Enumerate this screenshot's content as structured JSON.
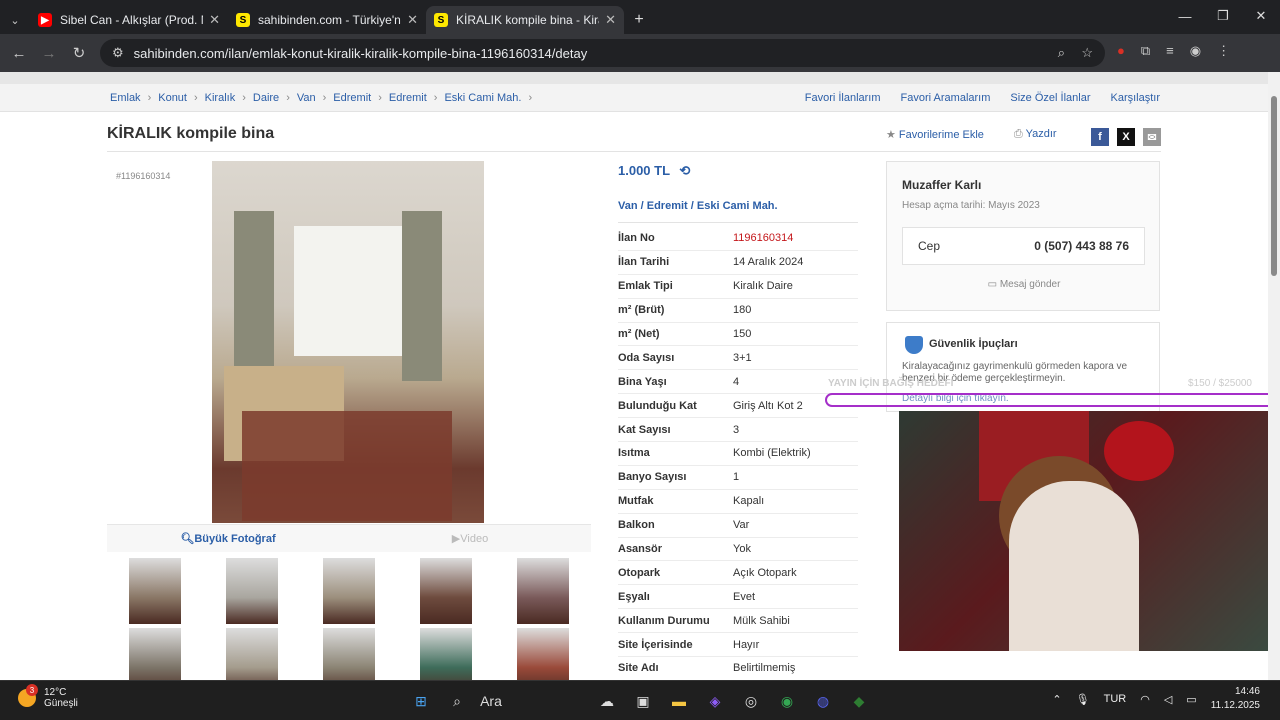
{
  "browser": {
    "tabs": [
      {
        "title": "Sibel Can - Alkışlar (Prod. M",
        "fav_color": "#ff0000",
        "fav_glyph": "▶",
        "active": false
      },
      {
        "title": "sahibinden.com - Türkiye'nin O",
        "fav_color": "#ffe800",
        "fav_glyph": "S",
        "active": false
      },
      {
        "title": "KİRALIK kompile bina - Kiralık D",
        "fav_color": "#ffe800",
        "fav_glyph": "S",
        "active": true
      }
    ],
    "new_tab_glyph": "+",
    "url": "sahibinden.com/ilan/emlak-konut-kiralik-kiralik-kompile-bina-1196160314/detay"
  },
  "breadcrumbs": [
    "Emlak",
    "Konut",
    "Kiralık",
    "Daire",
    "Van",
    "Edremit",
    "Edremit",
    "Eski Cami Mah."
  ],
  "top_links": [
    "Favori İlanlarım",
    "Favori Aramalarım",
    "Size Özel İlanlar",
    "Karşılaştır"
  ],
  "listing": {
    "title": "KİRALIK kompile bina",
    "number_tag": "#1196160314",
    "add_favorite": "Favorilerime Ekle",
    "print": "Yazdır",
    "price": "1.000 TL",
    "location": [
      "Van",
      "Edremit",
      "Eski Cami Mah."
    ],
    "big_photo": "Büyük Fotoğraf",
    "video": "Video"
  },
  "properties": [
    {
      "k": "İlan No",
      "v": "1196160314",
      "highlight": true
    },
    {
      "k": "İlan Tarihi",
      "v": "14 Aralık 2024"
    },
    {
      "k": "Emlak Tipi",
      "v": "Kiralık Daire"
    },
    {
      "k": "m² (Brüt)",
      "v": "180"
    },
    {
      "k": "m² (Net)",
      "v": "150"
    },
    {
      "k": "Oda Sayısı",
      "v": "3+1"
    },
    {
      "k": "Bina Yaşı",
      "v": "4"
    },
    {
      "k": "Bulunduğu Kat",
      "v": "Giriş Altı Kot 2"
    },
    {
      "k": "Kat Sayısı",
      "v": "3"
    },
    {
      "k": "Isıtma",
      "v": "Kombi (Elektrik)"
    },
    {
      "k": "Banyo Sayısı",
      "v": "1"
    },
    {
      "k": "Mutfak",
      "v": "Kapalı"
    },
    {
      "k": "Balkon",
      "v": "Var"
    },
    {
      "k": "Asansör",
      "v": "Yok"
    },
    {
      "k": "Otopark",
      "v": "Açık Otopark"
    },
    {
      "k": "Eşyalı",
      "v": "Evet"
    },
    {
      "k": "Kullanım Durumu",
      "v": "Mülk Sahibi"
    },
    {
      "k": "Site İçerisinde",
      "v": "Hayır"
    },
    {
      "k": "Site Adı",
      "v": "Belirtilmemiş"
    }
  ],
  "seller": {
    "name": "Muzaffer Karlı",
    "joined": "Hesap açma tarihi: Mayıs 2023",
    "phone_label": "Cep",
    "phone": "0 (507) 443 88 76",
    "message": "Mesaj gönder"
  },
  "safety": {
    "title": "Güvenlik İpuçları",
    "body": "Kiralayacağınız gayrimenkulü görmeden kapora ve benzeri bir ödeme gerçekleştirmeyin.",
    "link": "Detaylı bilgi için tıklayın."
  },
  "stream_overlay": {
    "text": "YAYIN İÇİN BAĞIŞ HEDEFİ",
    "amount": "$150 / $25000"
  },
  "thumb_colors": [
    "#8a7766",
    "#a9a69f",
    "#9c8f7d",
    "#6e4b3e",
    "#7a5a5a",
    "#7c7468",
    "#a49c8d",
    "#8b8474",
    "#3e6c5a",
    "#9a4a3a"
  ],
  "taskbar": {
    "temp": "12°C",
    "weather": "Güneşli",
    "notif": "3",
    "search": "Ara",
    "lang": "TUR",
    "time": "14:46",
    "date": "11.12.2025"
  }
}
